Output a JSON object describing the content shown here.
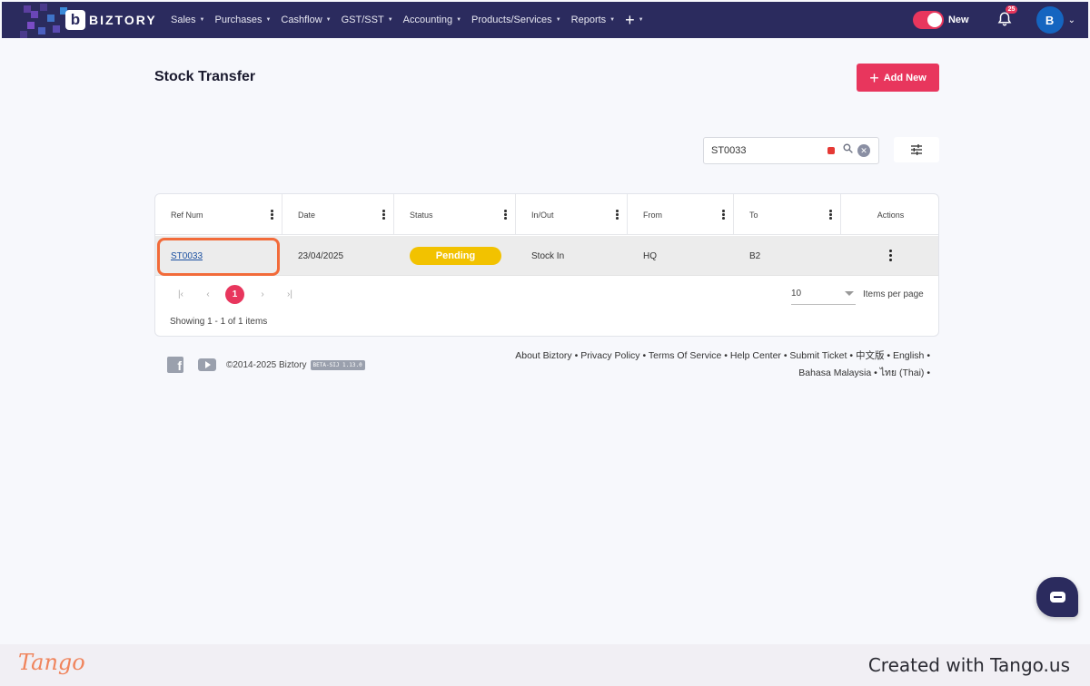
{
  "nav": {
    "brand": "BIZTORY",
    "brand_mark": "b",
    "menu": [
      {
        "label": "Sales"
      },
      {
        "label": "Purchases"
      },
      {
        "label": "Cashflow"
      },
      {
        "label": "GST/SST"
      },
      {
        "label": "Accounting"
      },
      {
        "label": "Products/Services"
      },
      {
        "label": "Reports"
      }
    ],
    "plus_label": "+",
    "toggle_label": "New",
    "notification_count": "25",
    "avatar_initial": "B"
  },
  "page": {
    "title": "Stock Transfer",
    "add_button": "Add New"
  },
  "search": {
    "value": "ST0033"
  },
  "table": {
    "columns": [
      "Ref Num",
      "Date",
      "Status",
      "In/Out",
      "From",
      "To",
      "Actions"
    ],
    "rows": [
      {
        "ref": "ST0033",
        "date": "23/04/2025",
        "status": "Pending",
        "in_out": "Stock In",
        "from": "HQ",
        "to": "B2"
      }
    ],
    "pager": {
      "first": "|‹",
      "prev": "‹",
      "current": "1",
      "next": "›",
      "last": "›|"
    },
    "per_page_value": "10",
    "per_page_label": "Items per page",
    "showing": "Showing 1 - 1 of 1 items"
  },
  "footer": {
    "copyright": "©2014-2025 Biztory",
    "version": "BETA-SIJ 1.13.0",
    "links_line1": "About Biztory • Privacy Policy • Terms Of Service • Help Center • Submit Ticket • 中文版 • English •",
    "links_line2": "Bahasa Malaysia • ไทย (Thai) •"
  },
  "tango": {
    "logo": "Tango",
    "created": "Created with Tango.us"
  },
  "colors": {
    "nav_bg": "#2b2b5e",
    "accent": "#e8365d",
    "pending": "#f2c200",
    "highlight": "#f26b3a"
  }
}
